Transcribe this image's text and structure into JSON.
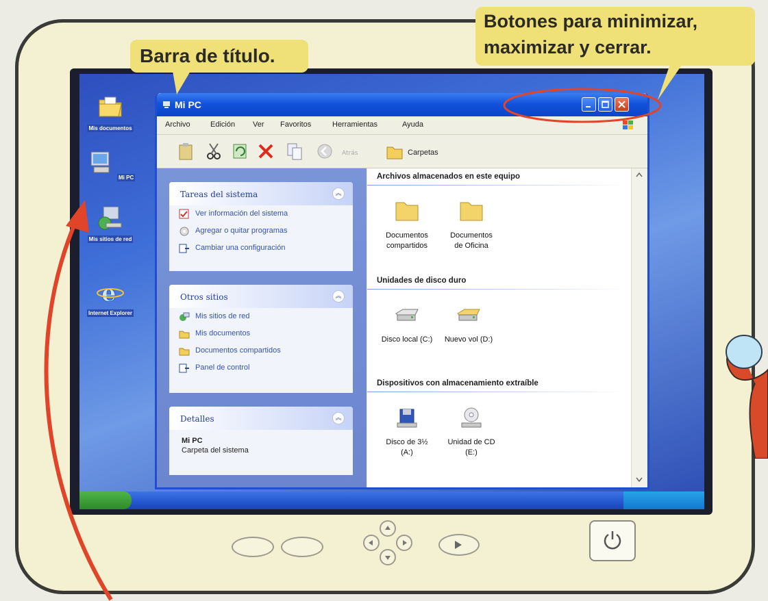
{
  "annotations": {
    "title_bar_label": "Barra de título.",
    "buttons_label_line1": "Botones para minimizar,",
    "buttons_label_line2": "maximizar y cerrar."
  },
  "desktop": {
    "icons": [
      {
        "label": "Mis documentos",
        "icon": "folder-documents-icon"
      },
      {
        "label": "Mi PC",
        "icon": "computer-icon"
      },
      {
        "label": "Mis sitios de red",
        "icon": "network-icon"
      },
      {
        "label": "Internet Explorer",
        "icon": "internet-explorer-icon"
      }
    ]
  },
  "window": {
    "title": "Mi PC",
    "menu": [
      "Archivo",
      "Edición",
      "Ver",
      "Favoritos",
      "Herramientas",
      "Ayuda"
    ],
    "toolbar": {
      "back_label": "Atrás",
      "folders_label": "Carpetas"
    },
    "tasks_panel": {
      "title": "Tareas del sistema",
      "items": [
        "Ver información del sistema",
        "Agregar o quitar programas",
        "Cambiar una configuración"
      ]
    },
    "other_places_panel": {
      "title": "Otros sitios",
      "items": [
        "Mis sitios de red",
        "Mis documentos",
        "Documentos compartidos",
        "Panel de control"
      ]
    },
    "details_panel": {
      "title": "Detalles",
      "name": "Mi PC",
      "description": "Carpeta del sistema"
    },
    "content": {
      "stored_files": {
        "title": "Archivos almacenados en este equipo",
        "items": [
          {
            "line1": "Documentos",
            "line2": "compartidos"
          },
          {
            "line1": "Documentos",
            "line2": "de Oficina"
          }
        ]
      },
      "hard_drives": {
        "title": "Unidades de disco duro",
        "items": [
          "Disco local (C:)",
          "Nuevo vol (D:)"
        ]
      },
      "removable": {
        "title": "Dispositivos con almacenamiento extraíble",
        "items": [
          {
            "line1": "Disco de 3½",
            "line2": "(A:)"
          },
          {
            "line1": "Unidad de CD",
            "line2": "(E:)"
          }
        ]
      }
    }
  },
  "colors": {
    "titlebar": "#0b45c8",
    "close_button": "#c4401c",
    "callout": "#efe078",
    "arrow": "#e0452a"
  }
}
